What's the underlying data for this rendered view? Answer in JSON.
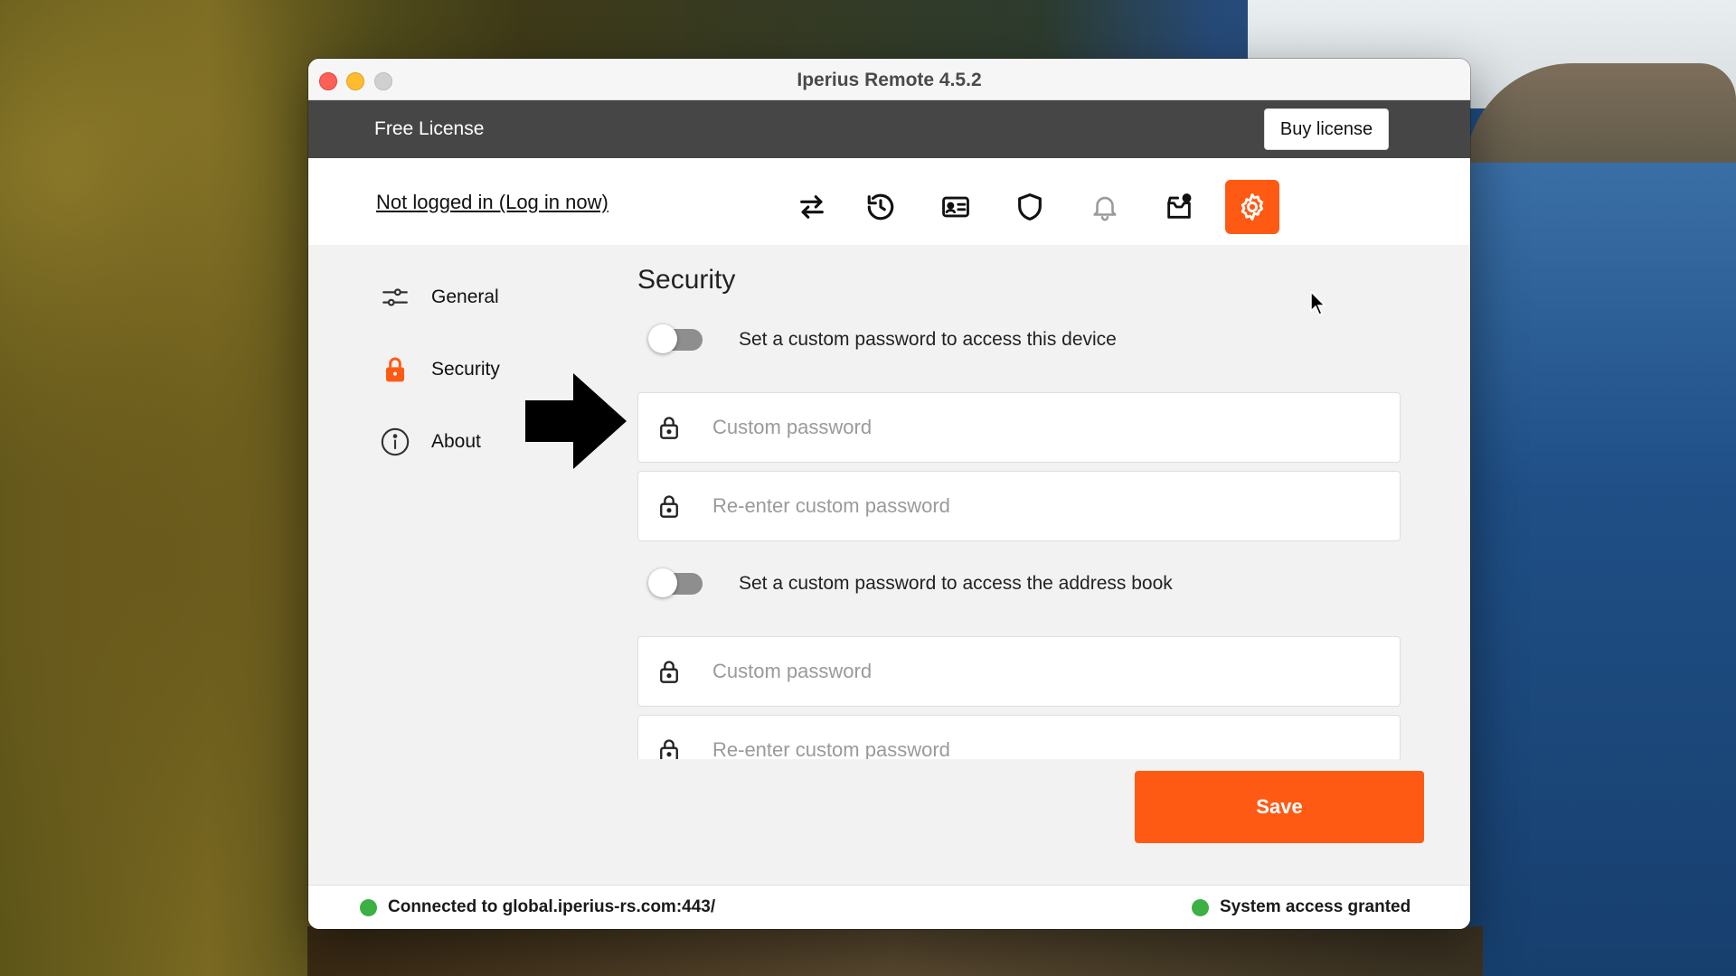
{
  "window": {
    "title": "Iperius Remote 4.5.2"
  },
  "license": {
    "label": "Free License",
    "buy_label": "Buy license"
  },
  "nav": {
    "login_link": "Not logged in (Log in now)",
    "icons": [
      "transfer-icon",
      "history-icon",
      "id-card-icon",
      "shield-icon",
      "bell-icon",
      "inbox-icon",
      "gear-icon"
    ],
    "active": "gear-icon",
    "accent_color": "#ff5a14"
  },
  "sidebar": {
    "items": [
      {
        "label": "General",
        "icon": "sliders-icon"
      },
      {
        "label": "Security",
        "icon": "lock-icon",
        "selected": true
      },
      {
        "label": "About",
        "icon": "info-icon"
      }
    ]
  },
  "security": {
    "title": "Security",
    "device": {
      "toggle_label": "Set a custom password to access this device",
      "toggle_on": false,
      "password_placeholder": "Custom password",
      "reenter_placeholder": "Re-enter custom password"
    },
    "address_book": {
      "toggle_label": "Set a custom password to access the address book",
      "toggle_on": false,
      "password_placeholder": "Custom password",
      "reenter_placeholder": "Re-enter custom password"
    },
    "save_label": "Save"
  },
  "status": {
    "connection": "Connected to global.iperius-rs.com:443/",
    "access": "System access granted",
    "ok_color": "#3cb043"
  }
}
